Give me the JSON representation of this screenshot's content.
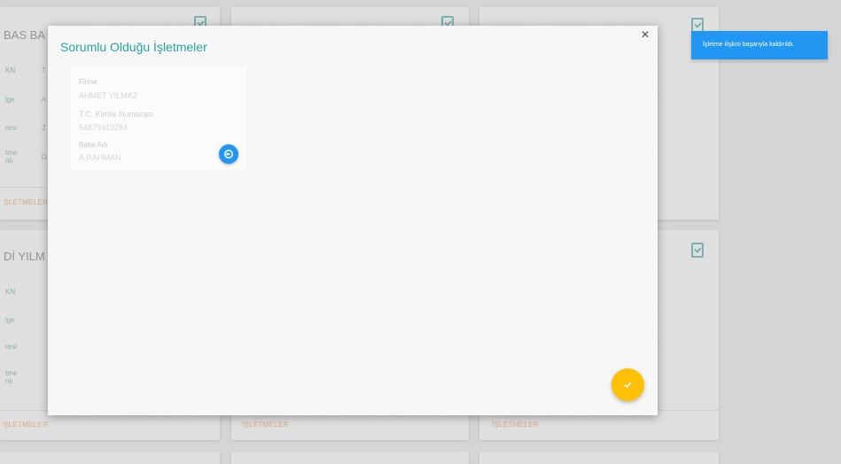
{
  "background_cards": {
    "top_left": {
      "title": "BAS BA",
      "labels": [
        "KN",
        "lge",
        "resi",
        "tme\nnlı"
      ],
      "values": [
        "T",
        "A",
        "Z",
        "D"
      ],
      "footer_link": "ŞLETMELER"
    },
    "middle_left": {
      "title": "Dİ YILM",
      "labels": [
        "KN",
        "lge",
        "resi",
        "tme\nnlı"
      ],
      "footer_link": "ŞLETMELER"
    },
    "bottom_footers": [
      "İŞLETMELER",
      "İŞLETMELER"
    ]
  },
  "modal": {
    "title": "Sorumlu Olduğu İşletmeler",
    "close_label": "×",
    "firm_card": {
      "firm_label": "Firma",
      "firm_value": "AHMET YILMAZ",
      "tc_label": "T.C. Kimlik Numarası",
      "tc_value": "54679419284",
      "father_label": "Baba Adı",
      "father_value": "A.RAHMAN",
      "action_icon": "unlink-icon"
    },
    "fab_icon": "check-icon"
  },
  "toast": {
    "message": "İşletme ilişkisi başarıyla kaldırıldı."
  },
  "colors": {
    "accent": "#26a69a",
    "primary": "#2196f3",
    "fab": "#ffc107",
    "link": "#e8b98a"
  }
}
